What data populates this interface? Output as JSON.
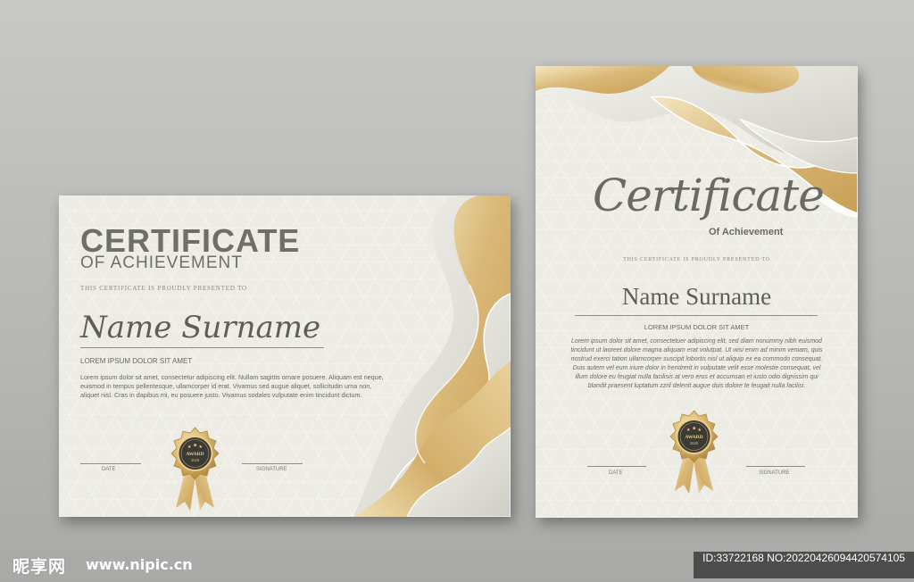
{
  "landscape": {
    "title": "CERTIFICATE",
    "subtitle": "OF ACHIEVEMENT",
    "presented": "THIS CERTIFICATE IS PROUDLY PRESENTED TO",
    "name": "Name Surname",
    "lorem": "LOREM IPSUM DOLOR SIT AMET",
    "paragraph": "Lorem ipsum dolor sit amet, consectetur adipiscing elit. Nullam sagittis ornare posuere. Aliquam est neque, euismod in tempus pellentesque, ullamcorper id erat. Vivamus sed augue aliquet, sollicitudin urna non, aliquet nisl. Cras in dapibus mi, eu posuere justo. Vivamus sodales vulputate enim tincidunt dictum.",
    "date_label": "DATE",
    "signature_label": "SIGNATURE"
  },
  "portrait": {
    "title": "Certificate",
    "subtitle": "Of Achievement",
    "presented": "THIS CERTIFICATE IS PROUDLY PRESENTED TO",
    "name": "Name Surname",
    "lorem": "LOREM IPSUM DOLOR SIT AMET",
    "paragraph": "Lorem ipsum dolor sit amet, consectetuer adipiscing elit, sed diam nonummy nibh euismod tincidunt ut laoreet dolore magna aliquam erat volutpat. Ut wisi enim ad minim veniam, quis nostrud exerci tation ullamcorper suscipit lobortis nisl ut aliquip ex ea commodo consequat. Duis autem vel eum iriure dolor in hendrerit in vulputate velit esse molestie consequat, vel illum dolore eu feugiat nulla facilisis at vero eros et accumsan et iusto odio dignissim qui blandit praesent luptatum zzril delenit augue duis dolore te feugait nulla facilisi.",
    "date_label": "DATE",
    "signature_label": "SIGNATURE"
  },
  "seal": {
    "text": "AWARD",
    "year": "2020"
  },
  "watermark": {
    "logo": "昵享网",
    "site": "www.nipic.cn",
    "id_text": "ID:33722168 NO:20220426094420574105"
  },
  "colors": {
    "paper": "#ecebe4",
    "gold_light": "#efdcae",
    "gold": "#d2ae6a",
    "silver": "#d9d8cf",
    "text": "#6f6e69"
  }
}
